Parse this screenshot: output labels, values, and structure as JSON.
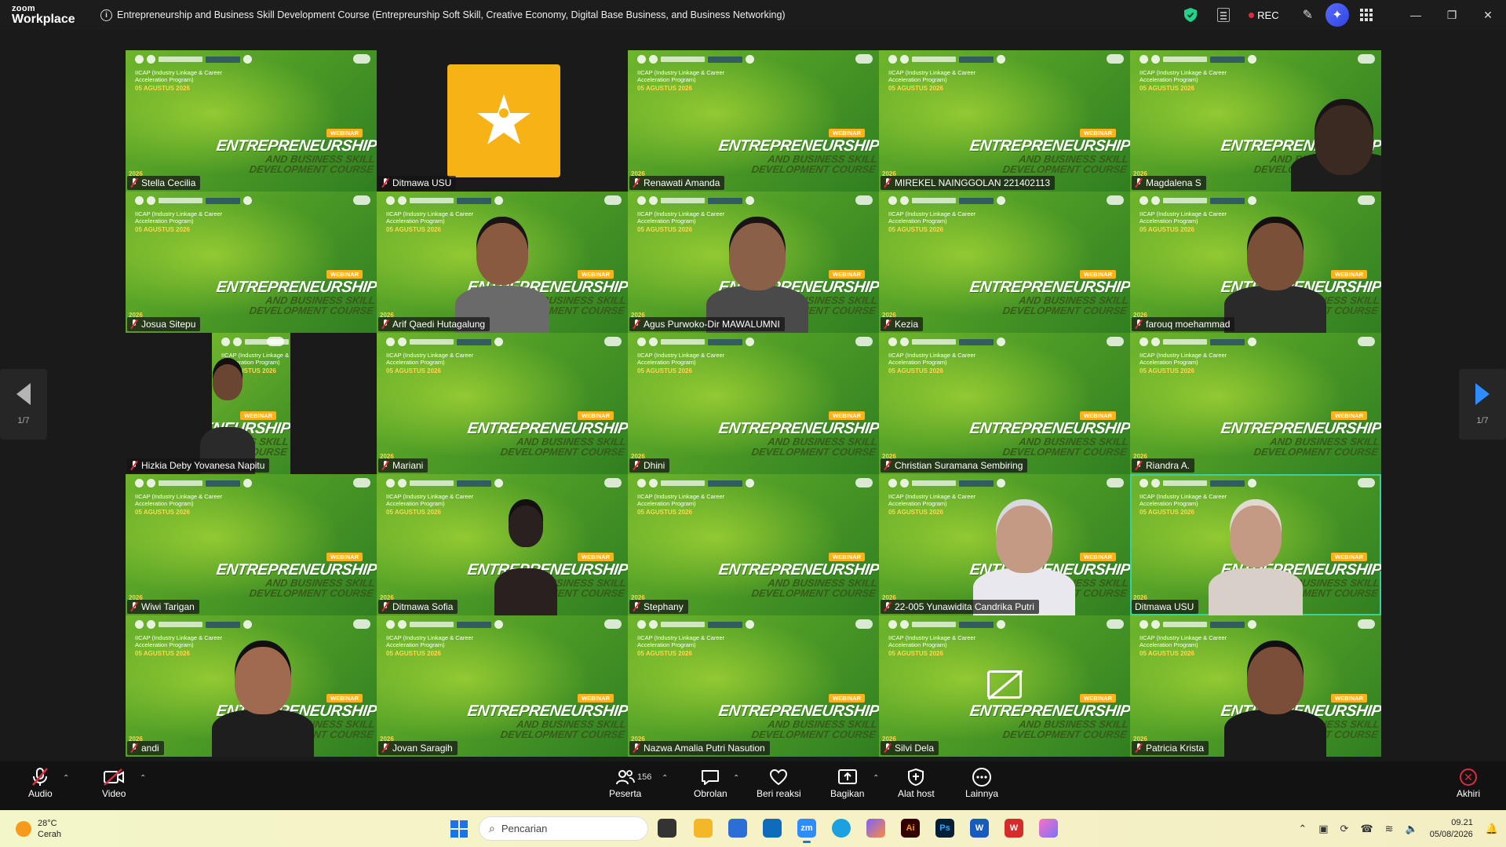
{
  "app": {
    "brand_line1": "zoom",
    "brand_line2": "Workplace"
  },
  "meeting": {
    "title": "Entrepreneurship and Business Skill Development Course (Entrepreurship Soft Skill, Creative Economy, Digital Base Business, and Business Networking)",
    "rec_label": "REC"
  },
  "slide": {
    "subtitle": "IICAP (Industry Linkage & Career Acceleration Program)",
    "date": "05 AGUSTUS 2026",
    "badge": "WEBINAR",
    "line1": "ENTREPRENEURSHIP",
    "line2": "AND BUSINESS SKILL",
    "line3": "DEVELOPMENT COURSE",
    "num": "2026"
  },
  "participants": [
    {
      "name": "Stella Cecilia",
      "type": "slide"
    },
    {
      "name": "Ditmawa USU",
      "type": "logo"
    },
    {
      "name": "Renawati Amanda",
      "type": "slide"
    },
    {
      "name": "MIREKEL NAINGGOLAN 221402113",
      "type": "slide"
    },
    {
      "name": "Magdalena S",
      "type": "slide"
    },
    {
      "name": "Josua Sitepu",
      "type": "slide"
    },
    {
      "name": "Arif Qaedi Hutagalung",
      "type": "slide"
    },
    {
      "name": "Agus Purwoko-Dir MAWALUMNI",
      "type": "slide"
    },
    {
      "name": "Kezia",
      "type": "slide"
    },
    {
      "name": "farouq moehammad",
      "type": "slide"
    },
    {
      "name": "Hizkia Deby Yovanesa Napitu",
      "type": "partial"
    },
    {
      "name": "Mariani",
      "type": "slide"
    },
    {
      "name": "Dhini",
      "type": "slide"
    },
    {
      "name": "Christian Suramana Sembiring",
      "type": "slide"
    },
    {
      "name": "Riandra A.",
      "type": "slide"
    },
    {
      "name": "Wiwi Tarigan",
      "type": "slide"
    },
    {
      "name": "Ditmawa Sofia",
      "type": "slide"
    },
    {
      "name": "Stephany",
      "type": "slide"
    },
    {
      "name": "22-005 Yunawidita Candrika Putri",
      "type": "slide"
    },
    {
      "name": "Ditmawa USU",
      "type": "slide"
    },
    {
      "name": "andi",
      "type": "slide"
    },
    {
      "name": "Jovan Saragih",
      "type": "slide"
    },
    {
      "name": "Nazwa Amalia Putri Nasution",
      "type": "slide"
    },
    {
      "name": "Silvi Dela",
      "type": "slide"
    },
    {
      "name": "Patricia Krista",
      "type": "slide"
    }
  ],
  "pager": {
    "left_label": "1/7",
    "right_label": "1/7"
  },
  "toolbar": {
    "audio": "Audio",
    "video": "Video",
    "participants": "Peserta",
    "participant_count": "156",
    "chat": "Obrolan",
    "react": "Beri reaksi",
    "share": "Bagikan",
    "host_tools": "Alat host",
    "more": "Lainnya",
    "end": "Akhiri"
  },
  "taskbar": {
    "temp": "28°C",
    "weather": "Cerah",
    "search_placeholder": "Pencarian",
    "time": "09.21",
    "date": "05/08/2026"
  },
  "colors": {
    "accent": "#2d8cff",
    "rec": "#e02b3e",
    "active_speaker": "#3ad1a2",
    "slide_green": "#4e9c26",
    "usu_gold": "#f7b316"
  }
}
